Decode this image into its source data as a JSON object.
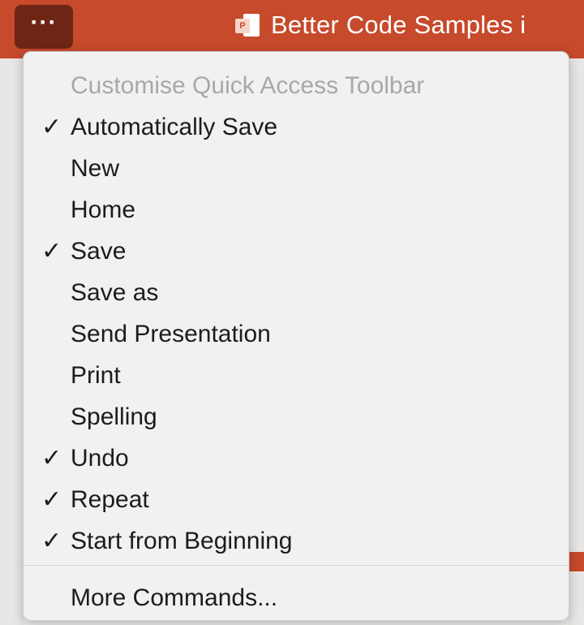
{
  "titlebar": {
    "more_label": "···",
    "app_badge": "P",
    "document_title": "Better Code Samples i"
  },
  "menu": {
    "header": "Customise Quick Access Toolbar",
    "checkmark": "✓",
    "items": [
      {
        "label": "Automatically Save",
        "checked": true
      },
      {
        "label": "New",
        "checked": false
      },
      {
        "label": "Home",
        "checked": false
      },
      {
        "label": "Save",
        "checked": true
      },
      {
        "label": "Save as",
        "checked": false
      },
      {
        "label": "Send Presentation",
        "checked": false
      },
      {
        "label": "Print",
        "checked": false
      },
      {
        "label": "Spelling",
        "checked": false
      },
      {
        "label": "Undo",
        "checked": true
      },
      {
        "label": "Repeat",
        "checked": true
      },
      {
        "label": "Start from Beginning",
        "checked": true
      }
    ],
    "more_commands": "More Commands..."
  },
  "colors": {
    "titlebar": "#c64a2b",
    "more_button": "#6e2514",
    "menu_background": "#f1f1f1",
    "header_text": "#a8a8a8"
  }
}
